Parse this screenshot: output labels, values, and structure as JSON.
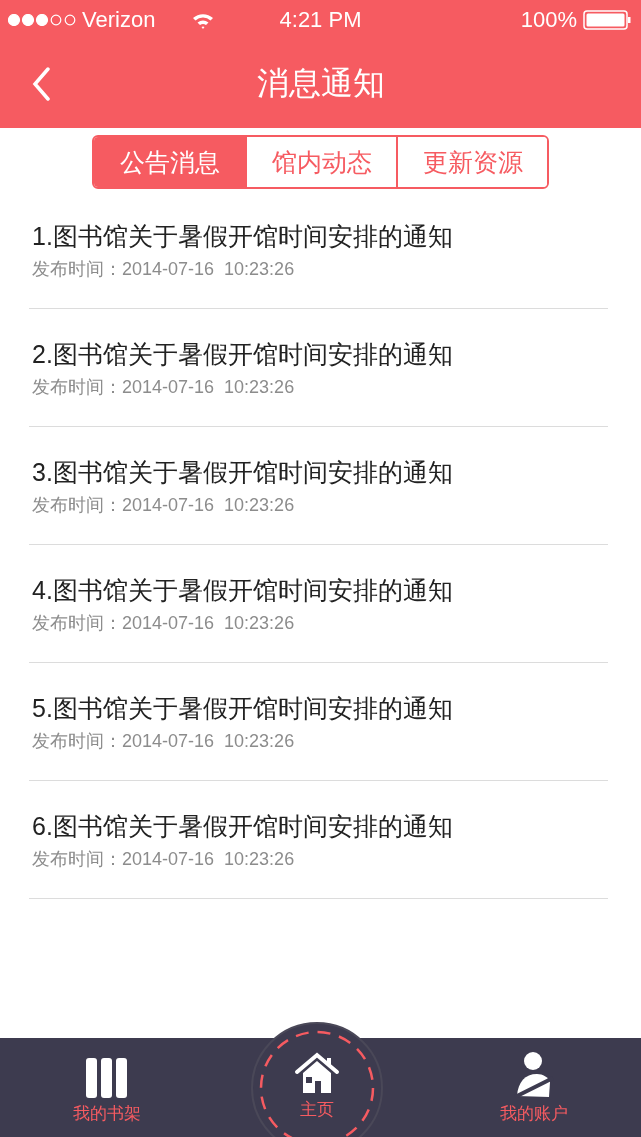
{
  "status_bar": {
    "carrier": "Verizon",
    "time": "4:21 PM",
    "battery": "100%"
  },
  "nav_bar": {
    "title": "消息通知"
  },
  "tabs": [
    {
      "label": "公告消息",
      "selected": true
    },
    {
      "label": "馆内动态",
      "selected": false
    },
    {
      "label": "更新资源",
      "selected": false
    }
  ],
  "notices": [
    {
      "title": "1.图书馆关于暑假开馆时间安排的通知",
      "date": "发布时间：2014-07-16  10:23:26"
    },
    {
      "title": "2.图书馆关于暑假开馆时间安排的通知",
      "date": "发布时间：2014-07-16  10:23:26"
    },
    {
      "title": "3.图书馆关于暑假开馆时间安排的通知",
      "date": "发布时间：2014-07-16  10:23:26"
    },
    {
      "title": "4.图书馆关于暑假开馆时间安排的通知",
      "date": "发布时间：2014-07-16  10:23:26"
    },
    {
      "title": "5.图书馆关于暑假开馆时间安排的通知",
      "date": "发布时间：2014-07-16  10:23:26"
    },
    {
      "title": "6.图书馆关于暑假开馆时间安排的通知",
      "date": "发布时间：2014-07-16  10:23:26"
    }
  ],
  "tab_bar": [
    {
      "kind": "shelf",
      "label": "我的书架"
    },
    {
      "kind": "home",
      "label": "主页"
    },
    {
      "kind": "account",
      "label": "我的账户"
    }
  ]
}
